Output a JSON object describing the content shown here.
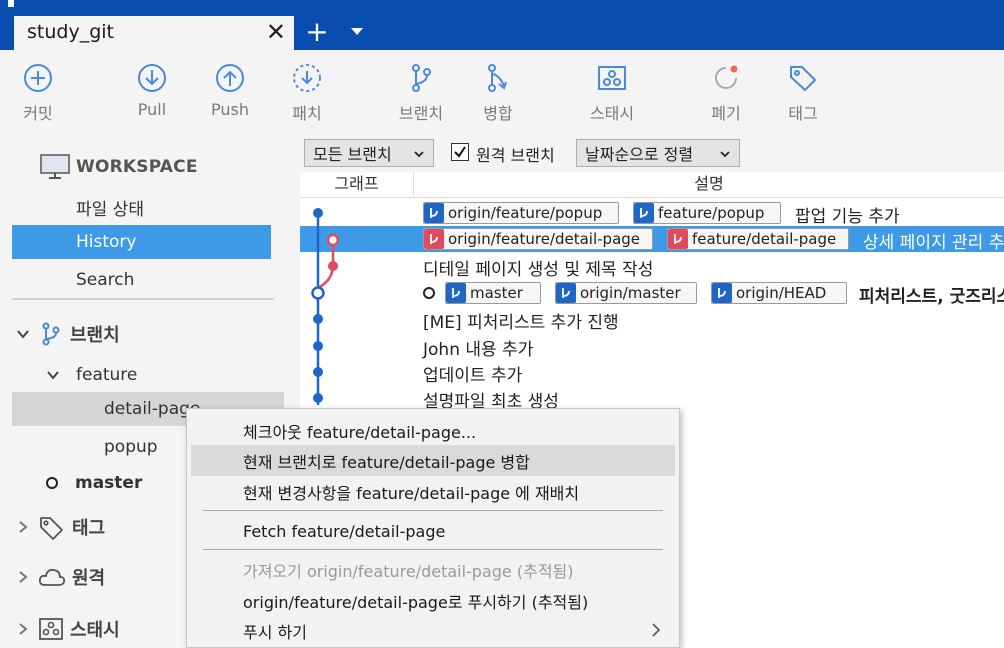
{
  "tab": {
    "title": "study_git"
  },
  "toolbar": {
    "commit": "커밋",
    "pull": "Pull",
    "push": "Push",
    "patch": "패치",
    "branch": "브랜치",
    "merge": "병합",
    "stash": "스태시",
    "discard": "폐기",
    "tag": "태그"
  },
  "sidebar": {
    "workspace": "WORKSPACE",
    "items": [
      "파일 상태",
      "History",
      "Search"
    ],
    "branches_label": "브랜치",
    "feature_folder": "feature",
    "branch_detail": "detail-page",
    "branch_popup": "popup",
    "branch_master": "master",
    "tags_label": "태그",
    "remotes_label": "원격",
    "stashes_label": "스태시"
  },
  "filter": {
    "branch_scope": "모든 브랜치",
    "remote_branch_label": "원격 브랜치",
    "remote_branch_checked": true,
    "sort": "날짜순으로 정렬"
  },
  "table": {
    "col_graph": "그래프",
    "col_desc": "설명"
  },
  "commits": [
    {
      "tags": [
        "origin/feature/popup",
        "feature/popup"
      ],
      "message": "팝업 기능 추가"
    },
    {
      "tags": [
        "origin/feature/detail-page",
        "feature/detail-page"
      ],
      "message": "상세 페이지 관리 추가"
    },
    {
      "tags": [],
      "message": "디테일 페이지 생성 및 제목 작성"
    },
    {
      "tags": [
        "master",
        "origin/master",
        "origin/HEAD"
      ],
      "message": "피처리스트, 굿즈리스트"
    },
    {
      "tags": [],
      "message": "[ME] 피처리스트 추가 진행"
    },
    {
      "tags": [],
      "message": "John 내용 추가"
    },
    {
      "tags": [],
      "message": "업데이트 추가"
    },
    {
      "tags": [],
      "message": "설명파일 최초 생성"
    }
  ],
  "context_menu": {
    "items": [
      "체크아웃 feature/detail-page...",
      "현재 브랜치로 feature/detail-page 병합",
      "현재 변경사항을 feature/detail-page 에 재배치",
      "Fetch feature/detail-page",
      "가져오기 origin/feature/detail-page (추적됨)",
      "origin/feature/detail-page로 푸시하기 (추적됨)",
      "푸시 하기"
    ]
  },
  "colors": {
    "accent": "#0a4db0",
    "selection": "#3e9ae6",
    "graph_blue": "#1f66c6",
    "graph_red": "#e24a5f"
  }
}
